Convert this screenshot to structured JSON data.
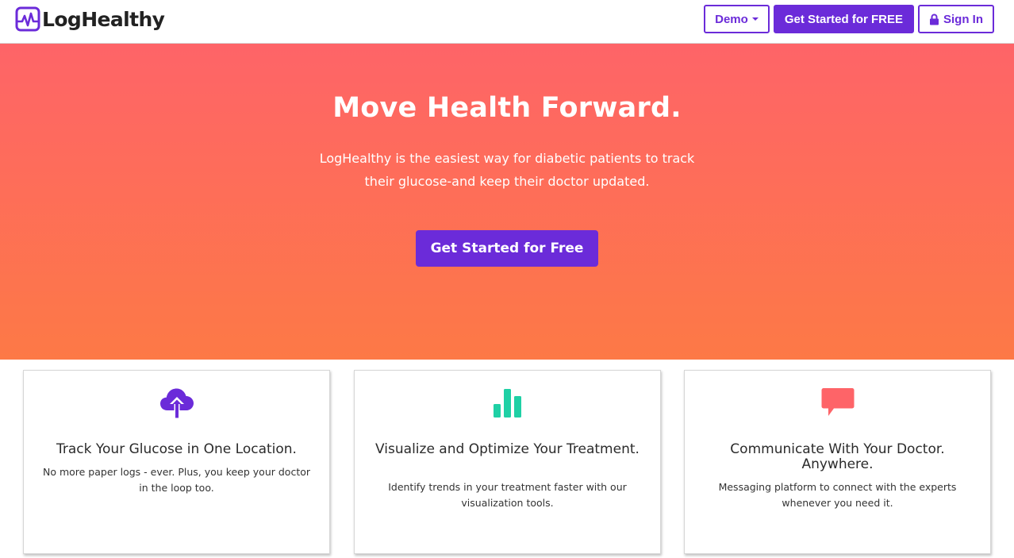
{
  "brand": {
    "name": "LogHealthy",
    "color": "#6b2bd9"
  },
  "nav": {
    "demo_label": "Demo",
    "get_started_label": "Get Started for FREE",
    "sign_in_label": "Sign In"
  },
  "hero": {
    "title": "Move Health Forward.",
    "subtitle": "LogHealthy is the easiest way for diabetic patients to track their glucose-and keep their doctor updated.",
    "cta_label": "Get Started for Free",
    "gradient_top": "#fe6468",
    "gradient_bottom": "#fd7946"
  },
  "features": [
    {
      "icon": "cloud-upload-icon",
      "icon_color": "#6b2bd9",
      "title": "Track Your Glucose in One Location.",
      "text": "No more paper logs - ever. Plus, you keep your doctor in the loop too."
    },
    {
      "icon": "bar-chart-icon",
      "icon_color": "#1fd0a5",
      "title": "Visualize and Optimize Your Treatment.",
      "text": "Identify trends in your treatment faster with our visualization tools."
    },
    {
      "icon": "chat-bubble-icon",
      "icon_color": "#fe6468",
      "title": "Communicate With Your Doctor. Anywhere.",
      "text": "Messaging platform to connect with the experts whenever you need it."
    }
  ]
}
